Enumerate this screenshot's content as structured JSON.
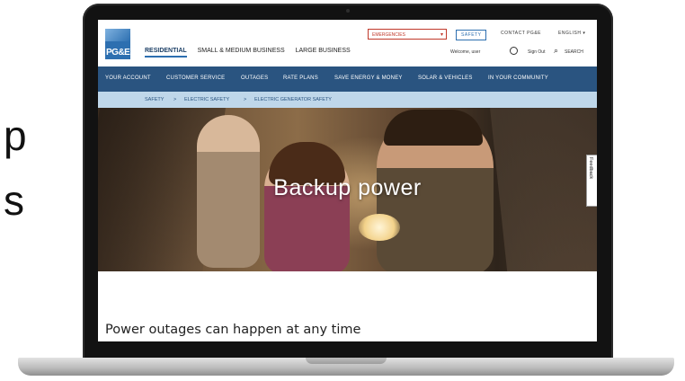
{
  "slide": {
    "letters": [
      "p",
      "s"
    ]
  },
  "header": {
    "logo_text": "PG&E",
    "emergencies": "EMERGENCIES",
    "safety": "SAFETY",
    "contact": "CONTACT PG&E",
    "language": "ENGLISH",
    "segments": [
      "RESIDENTIAL",
      "SMALL & MEDIUM BUSINESS",
      "LARGE BUSINESS"
    ],
    "welcome": "Welcome, user",
    "sign_out": "Sign Out",
    "search": "SEARCH"
  },
  "nav": {
    "items": [
      "YOUR ACCOUNT",
      "CUSTOMER SERVICE",
      "OUTAGES",
      "RATE PLANS",
      "SAVE ENERGY & MONEY",
      "SOLAR & VEHICLES",
      "IN YOUR COMMUNITY"
    ]
  },
  "breadcrumb": {
    "items": [
      "SAFETY",
      "ELECTRIC SAFETY",
      "ELECTRIC GENERATOR SAFETY"
    ],
    "separator": ">"
  },
  "hero": {
    "title": "Backup power",
    "feedback": "Feedback"
  },
  "content": {
    "heading": "Power outages can happen at any time"
  },
  "colors": {
    "nav": "#2a5480",
    "breadcrumb": "#bfd7ea",
    "brand": "#2d6fb0",
    "alert": "#c0392b"
  }
}
